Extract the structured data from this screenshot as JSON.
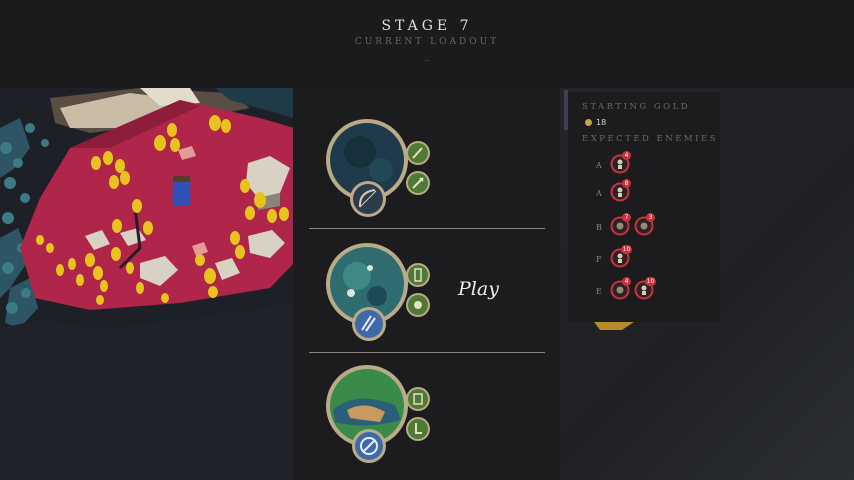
{
  "header": {
    "stage_title": "STAGE 7",
    "subtitle": "CURRENT LOADOUT"
  },
  "loadouts": [
    {
      "name": "loadout-1",
      "main_ability_icon": "bow-icon",
      "side_icons": [
        "feather-icon",
        "staff-icon"
      ],
      "terrain_color": "#1f3a4a"
    },
    {
      "name": "loadout-2",
      "main_ability_icon": "lightning-icon",
      "side_icons": [
        "totem-icon",
        "fist-icon"
      ],
      "terrain_color": "#2e6c70",
      "action_label": "Play"
    },
    {
      "name": "loadout-3",
      "main_ability_icon": "ban-icon",
      "side_icons": [
        "scroll-icon",
        "boot-icon"
      ],
      "terrain_color": "#3a8a4a"
    }
  ],
  "info": {
    "starting_gold_label": "STARTING GOLD",
    "gold_value": "18",
    "expected_enemies_label": "EXPECTED ENEMIES",
    "waves": [
      {
        "letter": "A",
        "enemies": [
          {
            "icon": "runner-enemy-icon",
            "count": "4"
          }
        ]
      },
      {
        "letter": "A",
        "enemies": [
          {
            "icon": "runner-enemy-icon",
            "count": "8"
          }
        ]
      },
      {
        "letter": "B",
        "enemies": [
          {
            "icon": "brute-enemy-icon",
            "count": "7"
          },
          {
            "icon": "brute-enemy-icon",
            "count": "3"
          }
        ]
      },
      {
        "letter": "F",
        "enemies": [
          {
            "icon": "runner-enemy-icon",
            "count": "10"
          }
        ]
      },
      {
        "letter": "E",
        "enemies": [
          {
            "icon": "brute-enemy-icon",
            "count": "4"
          },
          {
            "icon": "runner-enemy-icon",
            "count": "10"
          }
        ]
      }
    ]
  },
  "colors": {
    "accent_gold": "#c7a34a",
    "frame": "#b9ab88",
    "enemy_red": "#c8323c",
    "ability_blue": "#3f6aa8",
    "ability_green": "#5e8a3c",
    "map_territory": "#b0254a"
  }
}
